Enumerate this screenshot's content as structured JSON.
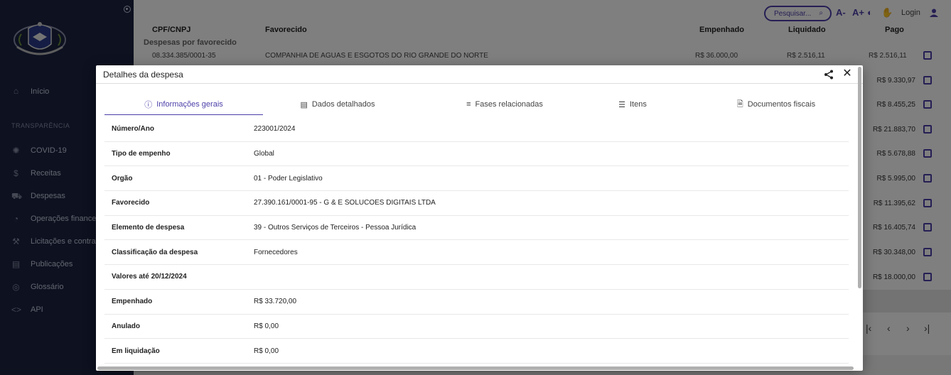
{
  "sidebar": {
    "home": "Início",
    "section": "TRANSPARÊNCIA",
    "items": [
      {
        "label": "COVID-19",
        "icon": "virus-icon"
      },
      {
        "label": "Receitas",
        "icon": "dollar-icon"
      },
      {
        "label": "Despesas",
        "icon": "cart-icon"
      },
      {
        "label": "Operações financeiras",
        "icon": "chart-icon"
      },
      {
        "label": "Licitações e contratos",
        "icon": "gavel-icon"
      },
      {
        "label": "Publicações",
        "icon": "book-icon"
      },
      {
        "label": "Glossário",
        "icon": "glossary-icon"
      },
      {
        "label": "API",
        "icon": "code-icon"
      }
    ]
  },
  "topbar": {
    "search_placeholder": "Pesquisar...",
    "font_decrease": "A-",
    "font_increase": "A+",
    "login": "Login"
  },
  "background_table": {
    "headers": {
      "cpf": "CPF/CNPJ",
      "favorecido": "Favorecido",
      "empenhado": "Empenhado",
      "liquidado": "Liquidado",
      "pago": "Pago"
    },
    "subtitle": "Despesas por favorecido",
    "first_row": {
      "cpf": "08.334.385/0001-35",
      "favorecido": "COMPANHIA DE AGUAS E ESGOTOS DO RIO GRANDE DO NORTE",
      "empenhado": "R$ 36.000,00",
      "liquidado": "R$ 2.516,11",
      "pago": "R$ 2.516,11"
    },
    "pago_values": [
      "R$ 9.330,97",
      "R$ 8.455,25",
      "R$ 21.883,70",
      "R$ 5.678,88",
      "R$ 5.995,00",
      "R$ 11.395,62",
      "R$ 16.405,74",
      "R$ 30.348,00",
      "R$ 18.000,00"
    ]
  },
  "modal": {
    "title": "Detalhes da despesa",
    "tabs": [
      {
        "label": "Informações gerais",
        "active": true
      },
      {
        "label": "Dados detalhados",
        "active": false
      },
      {
        "label": "Fases relacionadas",
        "active": false
      },
      {
        "label": "Itens",
        "active": false
      },
      {
        "label": "Documentos fiscais",
        "active": false
      }
    ],
    "rows": [
      {
        "key": "Número/Ano",
        "value": "223001/2024"
      },
      {
        "key": "Tipo de empenho",
        "value": "Global"
      },
      {
        "key": "Orgão",
        "value": "01 - Poder Legislativo"
      },
      {
        "key": "Favorecido",
        "value": "27.390.161/0001-95 - G & E SOLUCOES DIGITAIS LTDA"
      },
      {
        "key": "Elemento de despesa",
        "value": "39 - Outros Serviços de Terceiros - Pessoa Jurídica"
      },
      {
        "key": "Classificação da despesa",
        "value": "Fornecedores"
      },
      {
        "key": "Valores até 20/12/2024",
        "value": ""
      },
      {
        "key": "Empenhado",
        "value": "R$ 33.720,00"
      },
      {
        "key": "Anulado",
        "value": "R$ 0,00"
      },
      {
        "key": "Em liquidação",
        "value": "R$ 0,00"
      }
    ]
  },
  "colors": {
    "accent": "#4b3fa8",
    "sidebar": "#1a2240"
  }
}
